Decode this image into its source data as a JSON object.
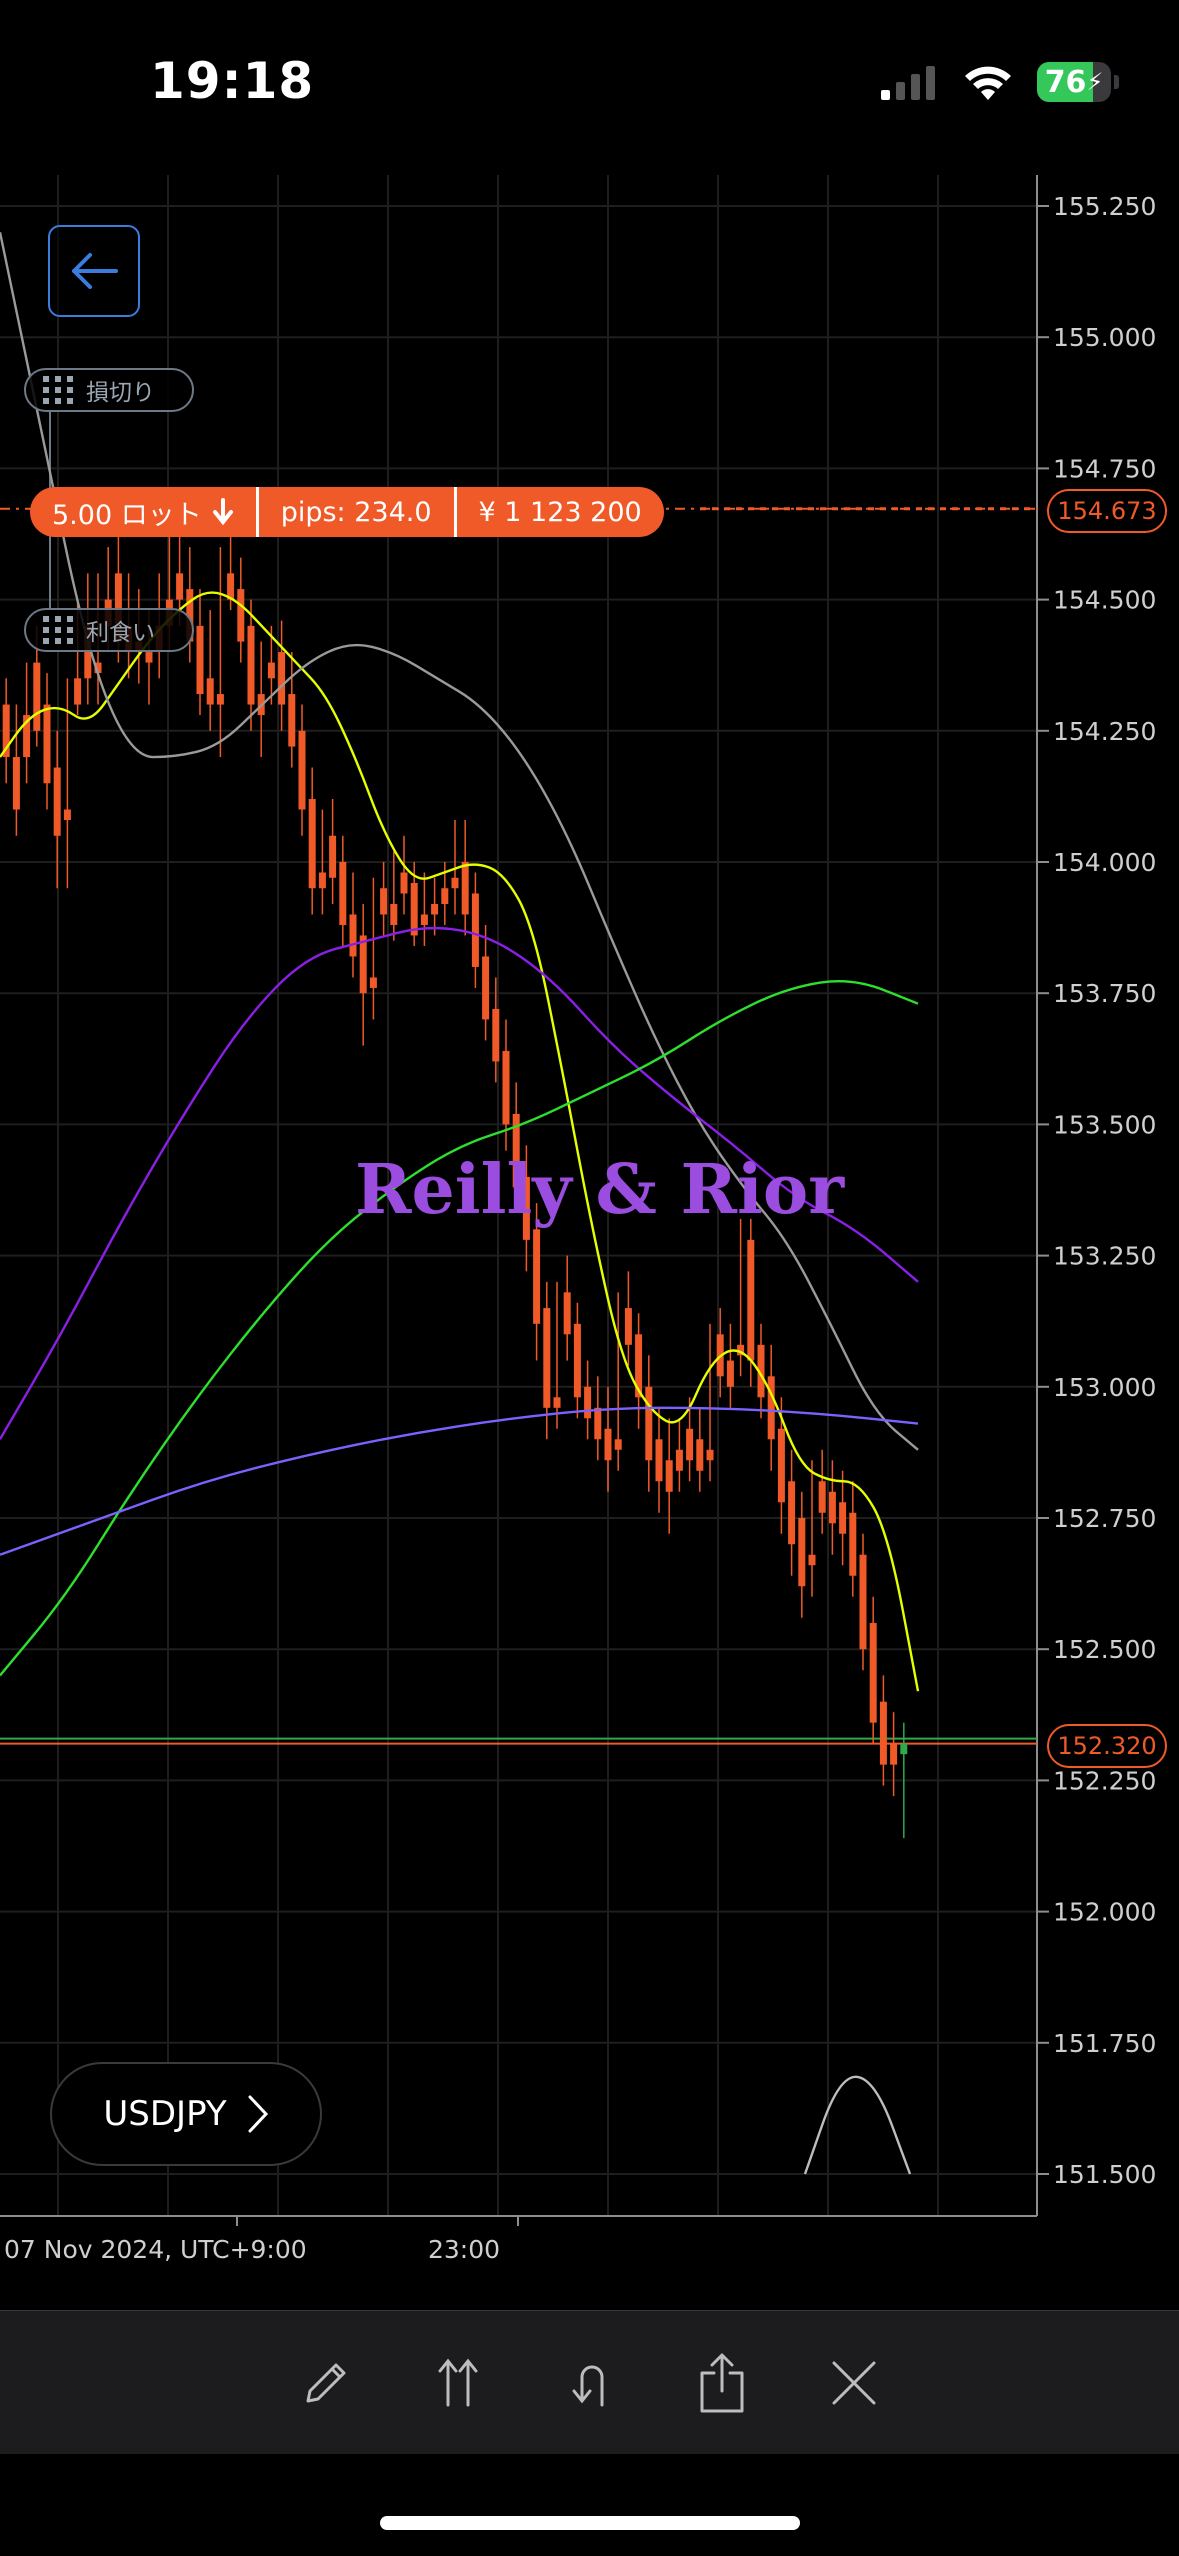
{
  "status_bar": {
    "time": "19:18",
    "battery_percent": 76,
    "battery_label": "76",
    "signal_icon": "cellular-signal-icon",
    "wifi_icon": "wifi-icon",
    "charging_icon": "bolt-icon"
  },
  "colors": {
    "bull": "#2fa84f",
    "bear": "#f05a28",
    "ema_fast": "#e4ff00",
    "ma_gray": "#9a9a9a",
    "ma_purple": "#8a1fe6",
    "ma_green": "#2ee02e",
    "ma_blue": "#7b62ff",
    "order": "#f05a28",
    "grid": "#1e1e1e"
  },
  "chart": {
    "symbol": "USDJPY",
    "date_label": "07 Nov 2024, UTC+9:00",
    "time_label": "23:00",
    "price_ticks": [
      "155.250",
      "155.000",
      "154.750",
      "154.500",
      "154.250",
      "154.000",
      "153.750",
      "153.500",
      "153.250",
      "153.000",
      "152.750",
      "152.500",
      "152.250",
      "152.000",
      "151.750",
      "151.500"
    ],
    "stop_loss_label": "損切り",
    "take_profit_label": "利食い",
    "order": {
      "lots": "5.00 ロット",
      "pips": "pips: 234.0",
      "amount": "¥ 1 123 200",
      "price": "154.673"
    },
    "current_price": "152.320",
    "watermark": "Reilly & Rior"
  },
  "chart_data": {
    "type": "candlestick",
    "x_labels": [
      "07 Nov 2024, UTC+9:00",
      "23:00"
    ],
    "y_range": [
      151.5,
      155.25
    ],
    "y_ticks": [
      155.25,
      155.0,
      154.75,
      154.5,
      154.25,
      154.0,
      153.75,
      153.5,
      153.25,
      153.0,
      152.75,
      152.5,
      152.25,
      152.0,
      151.75,
      151.5
    ],
    "entry_price": 154.673,
    "current_price": 152.32,
    "candles": [
      [
        154.25,
        154.32,
        154.2,
        154.1
      ],
      [
        154.3,
        154.35,
        154.2,
        154.15
      ],
      [
        154.2,
        154.3,
        154.1,
        154.05
      ],
      [
        154.28,
        154.38,
        154.2,
        154.15
      ],
      [
        154.38,
        154.45,
        154.25,
        154.22
      ],
      [
        154.3,
        154.36,
        154.15,
        154.1
      ],
      [
        154.18,
        154.25,
        154.05,
        153.95
      ],
      [
        154.1,
        154.35,
        154.08,
        153.95
      ],
      [
        154.35,
        154.5,
        154.3,
        154.28
      ],
      [
        154.45,
        154.55,
        154.35,
        154.3
      ],
      [
        154.38,
        154.55,
        154.36,
        154.3
      ],
      [
        154.5,
        154.6,
        154.45,
        154.4
      ],
      [
        154.55,
        154.62,
        154.42,
        154.38
      ],
      [
        154.45,
        154.55,
        154.4,
        154.35
      ],
      [
        154.42,
        154.52,
        154.4,
        154.34
      ],
      [
        154.4,
        154.48,
        154.38,
        154.3
      ],
      [
        154.45,
        154.55,
        154.4,
        154.35
      ],
      [
        154.5,
        154.62,
        154.45,
        154.4
      ],
      [
        154.55,
        154.65,
        154.5,
        154.45
      ],
      [
        154.52,
        154.6,
        154.42,
        154.38
      ],
      [
        154.45,
        154.52,
        154.32,
        154.28
      ],
      [
        154.35,
        154.48,
        154.3,
        154.25
      ],
      [
        154.32,
        154.6,
        154.3,
        154.2
      ],
      [
        154.55,
        154.62,
        154.5,
        154.48
      ],
      [
        154.52,
        154.58,
        154.42,
        154.38
      ],
      [
        154.45,
        154.5,
        154.3,
        154.25
      ],
      [
        154.32,
        154.42,
        154.28,
        154.2
      ],
      [
        154.38,
        154.45,
        154.35,
        154.3
      ],
      [
        154.4,
        154.46,
        154.3,
        154.25
      ],
      [
        154.32,
        154.4,
        154.22,
        154.18
      ],
      [
        154.25,
        154.3,
        154.1,
        154.05
      ],
      [
        154.12,
        154.18,
        153.95,
        153.9
      ],
      [
        153.98,
        154.1,
        153.95,
        153.9
      ],
      [
        154.05,
        154.12,
        153.97,
        153.92
      ],
      [
        154.0,
        154.05,
        153.88,
        153.84
      ],
      [
        153.9,
        153.98,
        153.82,
        153.78
      ],
      [
        153.86,
        153.92,
        153.75,
        153.65
      ],
      [
        153.78,
        153.97,
        153.76,
        153.7
      ],
      [
        153.95,
        154.0,
        153.9,
        153.86
      ],
      [
        153.92,
        154.02,
        153.88,
        153.85
      ],
      [
        153.98,
        154.05,
        153.94,
        153.9
      ],
      [
        153.96,
        154.0,
        153.86,
        153.84
      ],
      [
        153.9,
        153.98,
        153.88,
        153.84
      ],
      [
        153.92,
        153.97,
        153.9,
        153.86
      ],
      [
        153.95,
        154.0,
        153.92,
        153.88
      ],
      [
        153.97,
        154.08,
        153.95,
        153.9
      ],
      [
        154.0,
        154.08,
        153.9,
        153.86
      ],
      [
        153.94,
        153.98,
        153.8,
        153.76
      ],
      [
        153.82,
        153.88,
        153.7,
        153.66
      ],
      [
        153.72,
        153.78,
        153.62,
        153.58
      ],
      [
        153.64,
        153.7,
        153.5,
        153.45
      ],
      [
        153.52,
        153.58,
        153.38,
        153.34
      ],
      [
        153.4,
        153.46,
        153.28,
        153.22
      ],
      [
        153.3,
        153.35,
        153.12,
        153.05
      ],
      [
        153.15,
        153.2,
        152.96,
        152.9
      ],
      [
        152.98,
        153.2,
        152.96,
        152.92
      ],
      [
        153.18,
        153.25,
        153.1,
        153.05
      ],
      [
        153.12,
        153.16,
        152.98,
        152.94
      ],
      [
        153.0,
        153.05,
        152.94,
        152.9
      ],
      [
        152.96,
        153.02,
        152.9,
        152.86
      ],
      [
        152.92,
        153.0,
        152.86,
        152.8
      ],
      [
        152.9,
        153.18,
        152.88,
        152.84
      ],
      [
        153.15,
        153.22,
        153.08,
        153.04
      ],
      [
        153.1,
        153.14,
        152.98,
        152.92
      ],
      [
        153.0,
        153.06,
        152.86,
        152.8
      ],
      [
        152.9,
        152.96,
        152.82,
        152.76
      ],
      [
        152.86,
        152.94,
        152.8,
        152.72
      ],
      [
        152.88,
        152.94,
        152.84,
        152.8
      ],
      [
        152.92,
        152.98,
        152.86,
        152.82
      ],
      [
        152.9,
        152.96,
        152.84,
        152.8
      ],
      [
        152.88,
        153.12,
        152.86,
        152.82
      ],
      [
        153.1,
        153.15,
        153.02,
        152.98
      ],
      [
        153.05,
        153.12,
        153.0,
        152.96
      ],
      [
        153.08,
        153.32,
        153.06,
        153.02
      ],
      [
        153.28,
        153.32,
        153.05,
        153.0
      ],
      [
        153.08,
        153.12,
        152.98,
        152.94
      ],
      [
        153.02,
        153.08,
        152.9,
        152.84
      ],
      [
        152.92,
        152.98,
        152.78,
        152.72
      ],
      [
        152.82,
        152.88,
        152.7,
        152.64
      ],
      [
        152.75,
        152.8,
        152.62,
        152.56
      ],
      [
        152.68,
        152.86,
        152.66,
        152.6
      ],
      [
        152.82,
        152.88,
        152.76,
        152.72
      ],
      [
        152.8,
        152.86,
        152.74,
        152.68
      ],
      [
        152.78,
        152.84,
        152.72,
        152.66
      ],
      [
        152.76,
        152.82,
        152.64,
        152.6
      ],
      [
        152.68,
        152.72,
        152.5,
        152.46
      ],
      [
        152.55,
        152.6,
        152.36,
        152.32
      ],
      [
        152.4,
        152.45,
        152.28,
        152.24
      ],
      [
        152.32,
        152.38,
        152.28,
        152.22
      ],
      [
        152.3,
        152.36,
        152.32,
        152.14
      ]
    ],
    "series": [
      {
        "name": "",
        "color": "#e4ff00",
        "values": [
          154.2,
          154.28,
          154.3,
          154.26,
          154.34,
          154.42,
          154.48,
          154.52,
          154.5,
          154.44,
          154.38,
          154.32,
          154.2,
          154.05,
          153.96,
          153.98,
          154.0,
          153.98,
          153.88,
          153.6,
          153.3,
          153.05,
          152.95,
          152.92,
          153.05,
          153.08,
          153.0,
          152.85,
          152.82,
          152.82,
          152.72,
          152.42
        ]
      },
      {
        "name": "",
        "color": "#9a9a9a",
        "values": [
          155.2,
          154.8,
          154.4,
          154.2,
          154.2,
          154.22,
          154.3,
          154.38,
          154.42,
          154.4,
          154.35,
          154.3,
          154.2,
          154.05,
          153.85,
          153.66,
          153.5,
          153.38,
          153.28,
          153.12,
          152.95,
          152.88
        ]
      },
      {
        "name": "",
        "color": "#8a1fe6",
        "values": [
          152.9,
          153.1,
          153.32,
          153.52,
          153.7,
          153.82,
          153.85,
          153.88,
          153.86,
          153.78,
          153.65,
          153.55,
          153.46,
          153.36,
          153.3,
          153.2
        ]
      },
      {
        "name": "",
        "color": "#2ee02e",
        "values": [
          152.45,
          152.6,
          152.8,
          152.98,
          153.14,
          153.28,
          153.38,
          153.46,
          153.5,
          153.56,
          153.62,
          153.7,
          153.76,
          153.78,
          153.73
        ]
      },
      {
        "name": "",
        "color": "#7b62ff",
        "values": [
          152.68,
          152.75,
          152.82,
          152.87,
          152.91,
          152.94,
          152.96,
          152.96,
          152.95,
          152.93
        ]
      },
      {
        "name": "",
        "color": "#bdbdbd",
        "values": [
          151.5,
          151.69,
          151.68,
          151.5
        ]
      }
    ]
  },
  "toolbar": {
    "tools": [
      "pencil-icon",
      "arrows-up-icon",
      "undo-icon",
      "share-icon",
      "close-icon"
    ]
  }
}
